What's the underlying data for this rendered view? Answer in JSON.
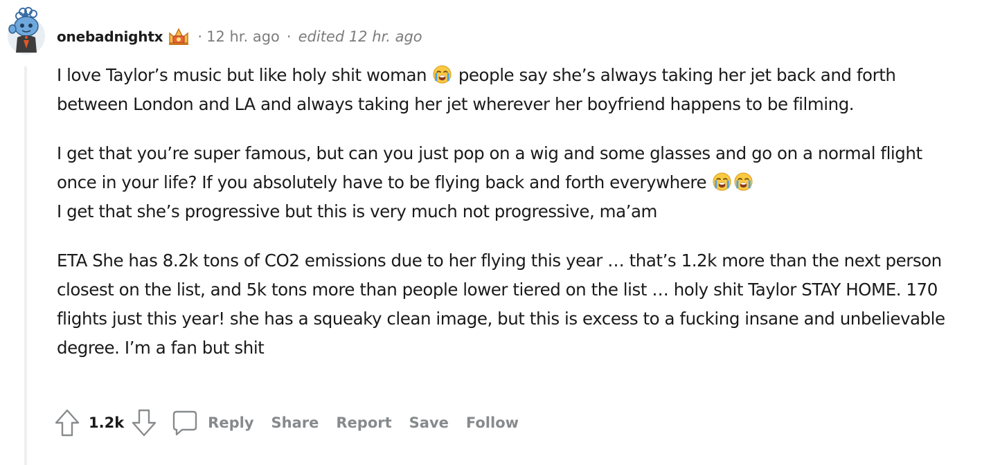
{
  "comment": {
    "username": "onebadnightx",
    "flair_icon": "trophy-crown-icon",
    "separator": "·",
    "timestamp": "12 hr. ago",
    "edited": "edited 12 hr. ago",
    "avatar_icon": "snoo-avatar-icon",
    "paragraphs": [
      {
        "parts": [
          "I love Taylor’s music but like holy shit woman",
          "people say she’s always taking her jet back and forth between London and LA and always taking her jet wherever her boyfriend happens to be filming."
        ]
      },
      {
        "parts": [
          "I get that you’re super famous, but can you just pop on a wig and some glasses and go on a normal flight once in your life? If you absolutely have to be flying back and forth everywhere",
          "I get that she’s progressive but this is very much not progressive, ma’am"
        ]
      },
      {
        "text": "ETA She has 8.2k tons of CO2 emissions due to her flying this year … that’s 1.2k more than the next person closest on the list, and 5k tons more than people lower tiered on the list … holy shit Taylor STAY HOME. 170 flights just this year! she has a squeaky clean image, but this is excess to a fucking insane and unbelievable degree. I’m a fan but shit"
      }
    ],
    "emoji_icon": "loudly-crying-face-icon"
  },
  "actions": {
    "score": "1.2k",
    "upvote_icon": "upvote-arrow-icon",
    "downvote_icon": "downvote-arrow-icon",
    "reply_icon": "speech-bubble-icon",
    "reply_label": "Reply",
    "share_label": "Share",
    "report_label": "Report",
    "save_label": "Save",
    "follow_label": "Follow"
  },
  "colors": {
    "text": "#1a1a1b",
    "meta": "#7c7c7c",
    "action": "#878a8c",
    "thread_line": "#edeff1",
    "avatar_blue": "#5b9bd5",
    "flair_orange": "#f0a23b"
  }
}
